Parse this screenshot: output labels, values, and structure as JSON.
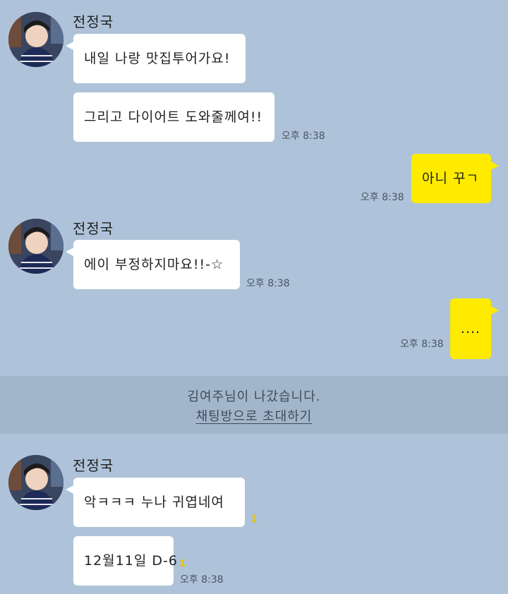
{
  "sender_name": "전정국",
  "messages": [
    {
      "text": "내일 나랑 맛집투어가요!"
    },
    {
      "text": "그리고 다이어트 도와줄께여!!",
      "time": "오후 8:38"
    },
    {
      "text": "아니 꾸ㄱ",
      "time": "오후 8:38"
    },
    {
      "text": "에이 부정하지마요!!-☆",
      "time": "오후 8:38"
    },
    {
      "text": "....",
      "time": "오후 8:38"
    },
    {
      "text": "악ㅋㅋㅋ 누나 귀엽네여",
      "unread": "1"
    },
    {
      "text": "12월11일 D-6",
      "unread": "1",
      "time": "오후 8:38"
    }
  ],
  "notice": {
    "text": "김여주님이 나갔습니다.",
    "link": "채팅방으로 초대하기"
  },
  "colors": {
    "background": "#aec3d9",
    "incoming_bubble": "#ffffff",
    "outgoing_bubble": "#ffeb00",
    "notice_band": "#a2b6cb",
    "unread_count": "#e9c400"
  },
  "icons": {
    "avatar": "profile-photo-avatar"
  }
}
